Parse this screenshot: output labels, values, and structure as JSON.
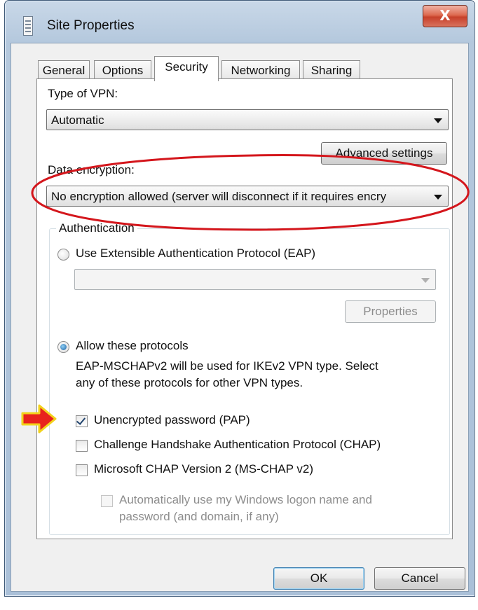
{
  "window": {
    "title": "Site Properties",
    "close_glyph": "X"
  },
  "tabs": [
    {
      "label": "General",
      "active": false
    },
    {
      "label": "Options",
      "active": false
    },
    {
      "label": "Security",
      "active": true
    },
    {
      "label": "Networking",
      "active": false
    },
    {
      "label": "Sharing",
      "active": false
    }
  ],
  "security": {
    "vpn_type_label": "Type of VPN:",
    "vpn_type_value": "Automatic",
    "advanced_settings_label": "Advanced settings",
    "data_encryption_label": "Data encryption:",
    "data_encryption_value": "No encryption allowed (server will disconnect if it requires encry",
    "authentication": {
      "group_label": "Authentication",
      "eap_radio_label": "Use Extensible Authentication Protocol (EAP)",
      "eap_selected": false,
      "eap_combo_value": "",
      "properties_label": "Properties",
      "allow_radio_label": "Allow these protocols",
      "allow_selected": true,
      "allow_note_line1": "EAP-MSCHAPv2 will be used for IKEv2 VPN type. Select",
      "allow_note_line2": "any of these protocols for other VPN types.",
      "protocols": [
        {
          "label": "Unencrypted password (PAP)",
          "checked": true
        },
        {
          "label": "Challenge Handshake Authentication Protocol (CHAP)",
          "checked": false
        },
        {
          "label": "Microsoft CHAP Version 2 (MS-CHAP v2)",
          "checked": false
        }
      ],
      "auto_logon_line1": "Automatically use my Windows logon name and",
      "auto_logon_line2": "password (and domain, if any)",
      "auto_logon_checked": false,
      "auto_logon_enabled": false
    }
  },
  "buttons": {
    "ok": "OK",
    "cancel": "Cancel"
  },
  "annotations": {
    "ellipse_color": "#d4161c",
    "arrow_color": "#e8221c",
    "arrow_outline": "#f2d21b"
  }
}
